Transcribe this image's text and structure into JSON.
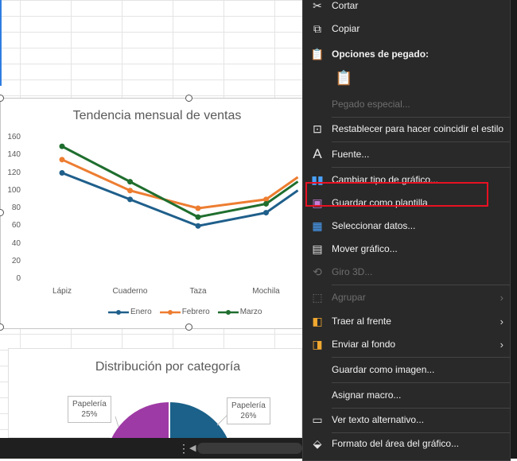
{
  "line_chart": {
    "title": "Tendencia mensual de ventas",
    "legend": [
      "Enero",
      "Febrero",
      "Marzo"
    ]
  },
  "pie_chart": {
    "title": "Distribución por categoría",
    "callouts": [
      {
        "label": "Papelería",
        "value": "25%"
      },
      {
        "label": "Papelería",
        "value": "26%"
      }
    ]
  },
  "chart_data": [
    {
      "type": "line",
      "title": "Tendencia mensual de ventas",
      "categories": [
        "Lápiz",
        "Cuaderno",
        "Taza",
        "Mochila"
      ],
      "ylim": [
        0,
        160
      ],
      "yticks": [
        "160",
        "140",
        "120",
        "100",
        "80",
        "60",
        "40",
        "20",
        "0"
      ],
      "grid": false,
      "legend_position": "bottom",
      "series": [
        {
          "name": "Enero",
          "color": "#1f5f8b",
          "values": [
            120,
            90,
            60,
            75
          ]
        },
        {
          "name": "Febrero",
          "color": "#ed7d31",
          "values": [
            135,
            100,
            80,
            90
          ]
        },
        {
          "name": "Marzo",
          "color": "#1f6e2e",
          "values": [
            150,
            110,
            70,
            85
          ]
        }
      ]
    },
    {
      "type": "pie",
      "title": "Distribución por categoría",
      "slices": [
        {
          "label": "Papelería",
          "value": 25,
          "color": "#9e3aa5"
        },
        {
          "label": "Papelería",
          "value": 26,
          "color": "#1b6189"
        }
      ]
    }
  ],
  "context_menu": {
    "items": [
      {
        "label": "Cortar",
        "icon": "scissors-icon",
        "disabled": false
      },
      {
        "label": "Copiar",
        "icon": "copy-icon",
        "disabled": false
      },
      {
        "label": "Opciones de pegado:",
        "icon": "paste-options-icon",
        "disabled": false,
        "bold": true
      },
      {
        "label": "",
        "icon": "paste-icon",
        "disabled": false
      },
      {
        "label": "Pegado especial...",
        "icon": "",
        "disabled": true
      },
      {
        "label": "Restablecer para hacer coincidir el estilo",
        "icon": "reset-style-icon",
        "disabled": false
      },
      {
        "label": "Fuente...",
        "icon": "font-icon",
        "disabled": false
      },
      {
        "label": "Cambiar tipo de gráfico...",
        "icon": "change-chart-type-icon",
        "disabled": false
      },
      {
        "label": "Guardar como plantilla",
        "icon": "save-template-icon",
        "disabled": false
      },
      {
        "label": "Seleccionar datos...",
        "icon": "select-data-icon",
        "disabled": false
      },
      {
        "label": "Mover gráfico...",
        "icon": "move-chart-icon",
        "disabled": false
      },
      {
        "label": "Giro 3D...",
        "icon": "rotate-3d-icon",
        "disabled": true
      },
      {
        "label": "Agrupar",
        "icon": "group-icon",
        "disabled": true,
        "submenu": true
      },
      {
        "label": "Traer al frente",
        "icon": "bring-front-icon",
        "disabled": false,
        "submenu": true
      },
      {
        "label": "Enviar al fondo",
        "icon": "send-back-icon",
        "disabled": false,
        "submenu": true
      },
      {
        "label": "Guardar como imagen...",
        "icon": "",
        "disabled": false
      },
      {
        "label": "Asignar macro...",
        "icon": "",
        "disabled": false
      },
      {
        "label": "Ver texto alternativo...",
        "icon": "alt-text-icon",
        "disabled": false
      },
      {
        "label": "Formato del área del gráfico...",
        "icon": "format-area-icon",
        "disabled": false
      }
    ]
  }
}
